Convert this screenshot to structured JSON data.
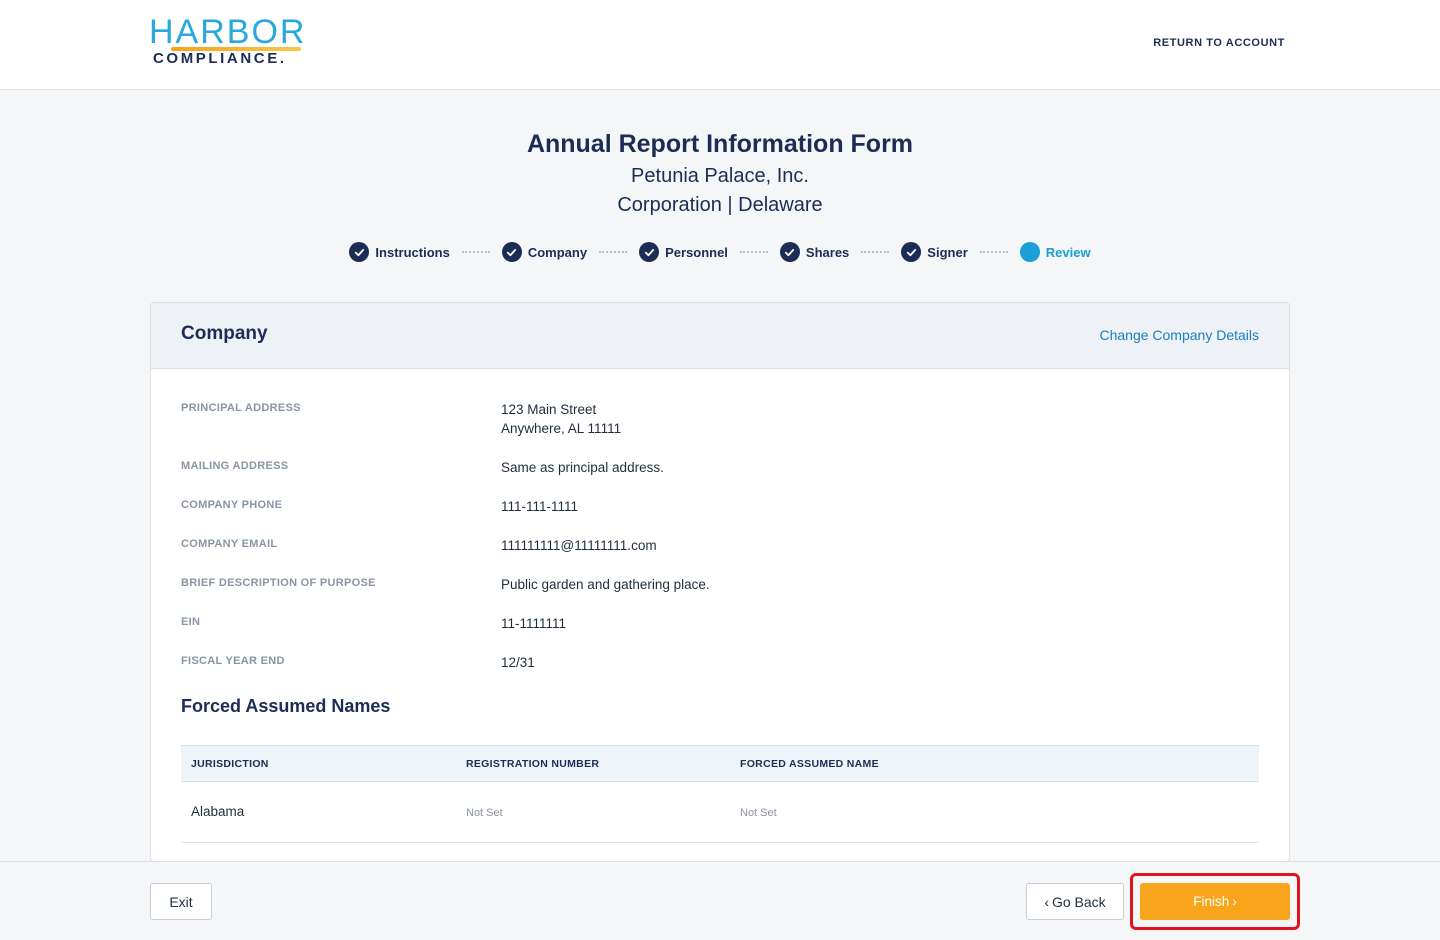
{
  "brand": {
    "name_top": "HARBOR",
    "name_bottom": "COMPLIANCE."
  },
  "topbar": {
    "return_label": "RETURN TO ACCOUNT"
  },
  "header": {
    "title": "Annual Report Information Form",
    "company_name": "Petunia Palace, Inc.",
    "entity": "Corporation | Delaware"
  },
  "steps": [
    {
      "label": "Instructions",
      "state": "complete"
    },
    {
      "label": "Company",
      "state": "complete"
    },
    {
      "label": "Personnel",
      "state": "complete"
    },
    {
      "label": "Shares",
      "state": "complete"
    },
    {
      "label": "Signer",
      "state": "complete"
    },
    {
      "label": "Review",
      "state": "current"
    }
  ],
  "company_card": {
    "title": "Company",
    "change_link": "Change Company Details",
    "fields": [
      {
        "label": "PRINCIPAL ADDRESS",
        "value_line1": "123 Main Street",
        "value_line2": "Anywhere, AL 11111"
      },
      {
        "label": "MAILING ADDRESS",
        "value_line1": "Same as principal address."
      },
      {
        "label": "COMPANY PHONE",
        "value_line1": "111-111-1111"
      },
      {
        "label": "COMPANY EMAIL",
        "value_line1": "111111111@11111111.com"
      },
      {
        "label": "BRIEF DESCRIPTION OF PURPOSE",
        "value_line1": "Public garden and gathering place."
      },
      {
        "label": "EIN",
        "value_line1": "11-1111111"
      },
      {
        "label": "FISCAL YEAR END",
        "value_line1": "12/31"
      }
    ]
  },
  "forced_assumed_names": {
    "title": "Forced Assumed Names",
    "columns": [
      "JURISDICTION",
      "REGISTRATION NUMBER",
      "FORCED ASSUMED NAME"
    ],
    "rows": [
      {
        "jurisdiction": "Alabama",
        "registration_number": "Not Set",
        "forced_assumed_name": "Not Set"
      }
    ]
  },
  "footer": {
    "exit_label": "Exit",
    "back_label": "Go Back",
    "finish_label": "Finish"
  },
  "colors": {
    "primary": "#1c2c55",
    "accent": "#1a9fd6",
    "finish": "#f9a51c",
    "highlight": "#e0141e"
  }
}
